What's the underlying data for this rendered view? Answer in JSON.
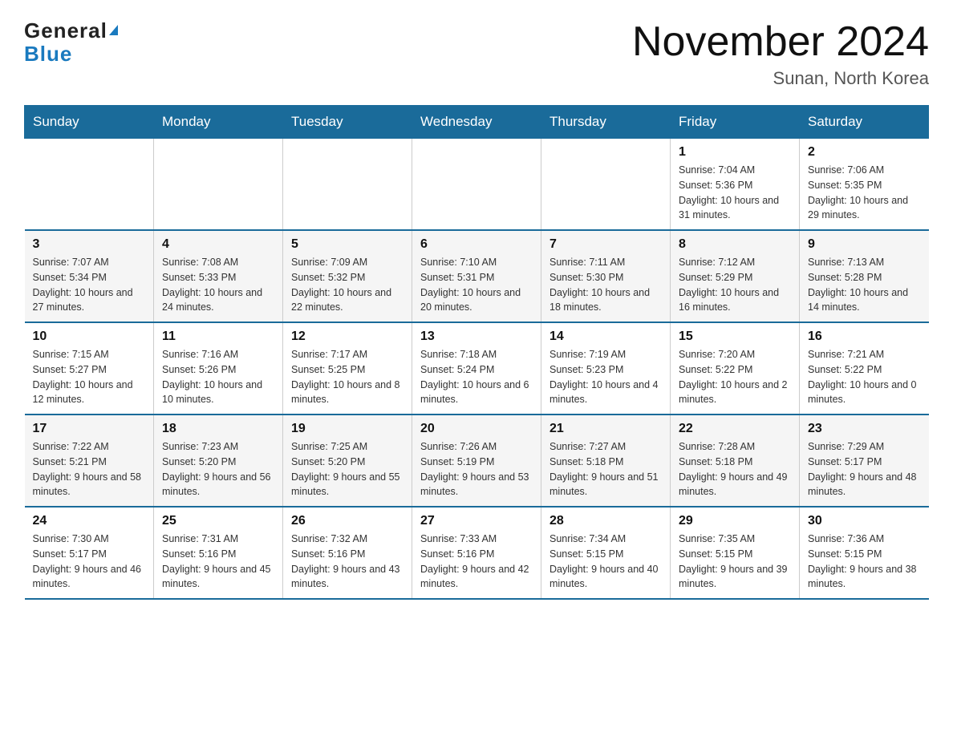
{
  "header": {
    "logo_general": "General",
    "logo_blue": "Blue",
    "month_title": "November 2024",
    "location": "Sunan, North Korea"
  },
  "days_of_week": [
    "Sunday",
    "Monday",
    "Tuesday",
    "Wednesday",
    "Thursday",
    "Friday",
    "Saturday"
  ],
  "weeks": [
    [
      {
        "day": "",
        "info": ""
      },
      {
        "day": "",
        "info": ""
      },
      {
        "day": "",
        "info": ""
      },
      {
        "day": "",
        "info": ""
      },
      {
        "day": "",
        "info": ""
      },
      {
        "day": "1",
        "info": "Sunrise: 7:04 AM\nSunset: 5:36 PM\nDaylight: 10 hours and 31 minutes."
      },
      {
        "day": "2",
        "info": "Sunrise: 7:06 AM\nSunset: 5:35 PM\nDaylight: 10 hours and 29 minutes."
      }
    ],
    [
      {
        "day": "3",
        "info": "Sunrise: 7:07 AM\nSunset: 5:34 PM\nDaylight: 10 hours and 27 minutes."
      },
      {
        "day": "4",
        "info": "Sunrise: 7:08 AM\nSunset: 5:33 PM\nDaylight: 10 hours and 24 minutes."
      },
      {
        "day": "5",
        "info": "Sunrise: 7:09 AM\nSunset: 5:32 PM\nDaylight: 10 hours and 22 minutes."
      },
      {
        "day": "6",
        "info": "Sunrise: 7:10 AM\nSunset: 5:31 PM\nDaylight: 10 hours and 20 minutes."
      },
      {
        "day": "7",
        "info": "Sunrise: 7:11 AM\nSunset: 5:30 PM\nDaylight: 10 hours and 18 minutes."
      },
      {
        "day": "8",
        "info": "Sunrise: 7:12 AM\nSunset: 5:29 PM\nDaylight: 10 hours and 16 minutes."
      },
      {
        "day": "9",
        "info": "Sunrise: 7:13 AM\nSunset: 5:28 PM\nDaylight: 10 hours and 14 minutes."
      }
    ],
    [
      {
        "day": "10",
        "info": "Sunrise: 7:15 AM\nSunset: 5:27 PM\nDaylight: 10 hours and 12 minutes."
      },
      {
        "day": "11",
        "info": "Sunrise: 7:16 AM\nSunset: 5:26 PM\nDaylight: 10 hours and 10 minutes."
      },
      {
        "day": "12",
        "info": "Sunrise: 7:17 AM\nSunset: 5:25 PM\nDaylight: 10 hours and 8 minutes."
      },
      {
        "day": "13",
        "info": "Sunrise: 7:18 AM\nSunset: 5:24 PM\nDaylight: 10 hours and 6 minutes."
      },
      {
        "day": "14",
        "info": "Sunrise: 7:19 AM\nSunset: 5:23 PM\nDaylight: 10 hours and 4 minutes."
      },
      {
        "day": "15",
        "info": "Sunrise: 7:20 AM\nSunset: 5:22 PM\nDaylight: 10 hours and 2 minutes."
      },
      {
        "day": "16",
        "info": "Sunrise: 7:21 AM\nSunset: 5:22 PM\nDaylight: 10 hours and 0 minutes."
      }
    ],
    [
      {
        "day": "17",
        "info": "Sunrise: 7:22 AM\nSunset: 5:21 PM\nDaylight: 9 hours and 58 minutes."
      },
      {
        "day": "18",
        "info": "Sunrise: 7:23 AM\nSunset: 5:20 PM\nDaylight: 9 hours and 56 minutes."
      },
      {
        "day": "19",
        "info": "Sunrise: 7:25 AM\nSunset: 5:20 PM\nDaylight: 9 hours and 55 minutes."
      },
      {
        "day": "20",
        "info": "Sunrise: 7:26 AM\nSunset: 5:19 PM\nDaylight: 9 hours and 53 minutes."
      },
      {
        "day": "21",
        "info": "Sunrise: 7:27 AM\nSunset: 5:18 PM\nDaylight: 9 hours and 51 minutes."
      },
      {
        "day": "22",
        "info": "Sunrise: 7:28 AM\nSunset: 5:18 PM\nDaylight: 9 hours and 49 minutes."
      },
      {
        "day": "23",
        "info": "Sunrise: 7:29 AM\nSunset: 5:17 PM\nDaylight: 9 hours and 48 minutes."
      }
    ],
    [
      {
        "day": "24",
        "info": "Sunrise: 7:30 AM\nSunset: 5:17 PM\nDaylight: 9 hours and 46 minutes."
      },
      {
        "day": "25",
        "info": "Sunrise: 7:31 AM\nSunset: 5:16 PM\nDaylight: 9 hours and 45 minutes."
      },
      {
        "day": "26",
        "info": "Sunrise: 7:32 AM\nSunset: 5:16 PM\nDaylight: 9 hours and 43 minutes."
      },
      {
        "day": "27",
        "info": "Sunrise: 7:33 AM\nSunset: 5:16 PM\nDaylight: 9 hours and 42 minutes."
      },
      {
        "day": "28",
        "info": "Sunrise: 7:34 AM\nSunset: 5:15 PM\nDaylight: 9 hours and 40 minutes."
      },
      {
        "day": "29",
        "info": "Sunrise: 7:35 AM\nSunset: 5:15 PM\nDaylight: 9 hours and 39 minutes."
      },
      {
        "day": "30",
        "info": "Sunrise: 7:36 AM\nSunset: 5:15 PM\nDaylight: 9 hours and 38 minutes."
      }
    ]
  ]
}
